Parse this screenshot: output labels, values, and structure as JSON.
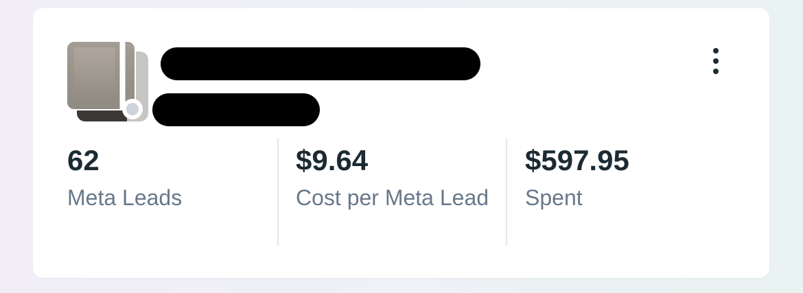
{
  "card": {
    "thumbnail_icon": "ad-thumbnail-image",
    "status_icon": "status-dot-icon",
    "status_color": "#cdd2db",
    "more_icon": "more-vertical-icon"
  },
  "metrics": [
    {
      "value": "62",
      "label": "Meta Leads"
    },
    {
      "value": "$9.64",
      "label": "Cost per Meta Lead"
    },
    {
      "value": "$597.95",
      "label": "Spent"
    }
  ],
  "colors": {
    "value_text": "#1c2b33",
    "label_text": "#67788a",
    "divider": "#e4e7eb",
    "redaction": "#000000"
  }
}
